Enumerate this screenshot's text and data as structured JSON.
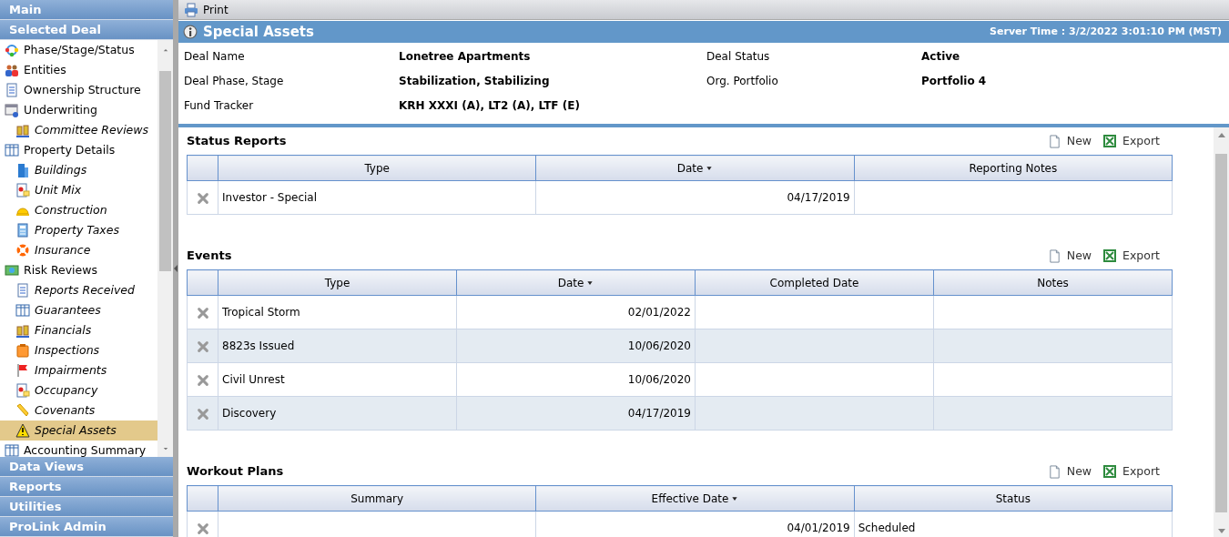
{
  "sidebar": {
    "top_sections": [
      {
        "label": "Main"
      },
      {
        "label": "Selected Deal"
      }
    ],
    "items": [
      {
        "label": "Phase/Stage/Status",
        "kind": "top",
        "selected": false
      },
      {
        "label": "Entities",
        "kind": "top",
        "selected": false
      },
      {
        "label": "Ownership Structure",
        "kind": "top",
        "selected": false
      },
      {
        "label": "Underwriting",
        "kind": "top",
        "selected": false
      },
      {
        "label": "Committee Reviews",
        "kind": "sub",
        "selected": false
      },
      {
        "label": "Property Details",
        "kind": "top",
        "selected": false
      },
      {
        "label": "Buildings",
        "kind": "sub",
        "selected": false
      },
      {
        "label": "Unit Mix",
        "kind": "sub",
        "selected": false
      },
      {
        "label": "Construction",
        "kind": "sub",
        "selected": false
      },
      {
        "label": "Property Taxes",
        "kind": "sub",
        "selected": false
      },
      {
        "label": "Insurance",
        "kind": "sub",
        "selected": false
      },
      {
        "label": "Risk Reviews",
        "kind": "top",
        "selected": false
      },
      {
        "label": "Reports Received",
        "kind": "sub",
        "selected": false
      },
      {
        "label": "Guarantees",
        "kind": "sub",
        "selected": false
      },
      {
        "label": "Financials",
        "kind": "sub",
        "selected": false
      },
      {
        "label": "Inspections",
        "kind": "sub",
        "selected": false
      },
      {
        "label": "Impairments",
        "kind": "sub",
        "selected": false
      },
      {
        "label": "Occupancy",
        "kind": "sub",
        "selected": false
      },
      {
        "label": "Covenants",
        "kind": "sub",
        "selected": false
      },
      {
        "label": "Special Assets",
        "kind": "sub",
        "selected": true
      },
      {
        "label": "Accounting Summary",
        "kind": "top",
        "selected": false
      }
    ],
    "bottom_sections": [
      {
        "label": "Data Views"
      },
      {
        "label": "Reports"
      },
      {
        "label": "Utilities"
      },
      {
        "label": "ProLink Admin"
      }
    ]
  },
  "toolbar": {
    "print": "Print"
  },
  "page": {
    "title": "Special Assets",
    "server_time": "Server Time : 3/2/2022 3:01:10 PM (MST)"
  },
  "deal_info": [
    {
      "label": "Deal Name",
      "value": "Lonetree Apartments"
    },
    {
      "label": "Deal Status",
      "value": "Active"
    },
    {
      "label": "Deal Phase, Stage",
      "value": "Stabilization, Stabilizing"
    },
    {
      "label": "Org. Portfolio",
      "value": "Portfolio 4"
    },
    {
      "label": "Fund Tracker",
      "value": "KRH XXXI (A), LT2 (A), LTF (E)"
    }
  ],
  "sections": [
    {
      "title": "Status Reports",
      "new": "New",
      "export": "Export",
      "columns": [
        {
          "label": "Type",
          "sorted": false
        },
        {
          "label": "Date",
          "sorted": true
        },
        {
          "label": "Reporting Notes",
          "sorted": false
        }
      ],
      "rows": [
        [
          "Investor - Special",
          "04/17/2019",
          ""
        ]
      ]
    },
    {
      "title": "Events",
      "new": "New",
      "export": "Export",
      "columns": [
        {
          "label": "Type",
          "sorted": false
        },
        {
          "label": "Date",
          "sorted": true
        },
        {
          "label": "Completed Date",
          "sorted": false
        },
        {
          "label": "Notes",
          "sorted": false
        }
      ],
      "rows": [
        [
          "Tropical Storm",
          "02/01/2022",
          "",
          ""
        ],
        [
          "8823s Issued",
          "10/06/2020",
          "",
          ""
        ],
        [
          "Civil Unrest",
          "10/06/2020",
          "",
          ""
        ],
        [
          "Discovery",
          "04/17/2019",
          "",
          ""
        ]
      ]
    },
    {
      "title": "Workout Plans",
      "new": "New",
      "export": "Export",
      "columns": [
        {
          "label": "Summary",
          "sorted": false
        },
        {
          "label": "Effective Date",
          "sorted": true
        },
        {
          "label": "Status",
          "sorted": false
        }
      ],
      "rows": [
        [
          "",
          "04/01/2019",
          "Scheduled"
        ]
      ]
    }
  ]
}
